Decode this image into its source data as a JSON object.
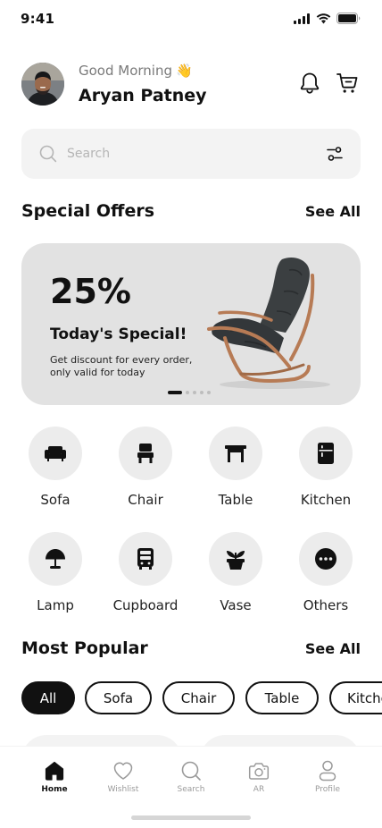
{
  "status_bar": {
    "time": "9:41"
  },
  "header": {
    "greeting": "Good Morning",
    "greeting_emoji": "👋",
    "user_name": "Aryan Patney"
  },
  "search": {
    "placeholder": "Search"
  },
  "special_offers": {
    "title": "Special Offers",
    "see_all": "See All",
    "offer": {
      "percent": "25%",
      "title": "Today's Special!",
      "description": "Get discount for every order, only valid for today"
    },
    "carousel": {
      "count": 5,
      "active_index": 0
    }
  },
  "categories": [
    {
      "label": "Sofa",
      "icon": "sofa-icon"
    },
    {
      "label": "Chair",
      "icon": "chair-icon"
    },
    {
      "label": "Table",
      "icon": "table-icon"
    },
    {
      "label": "Kitchen",
      "icon": "kitchen-icon"
    },
    {
      "label": "Lamp",
      "icon": "lamp-icon"
    },
    {
      "label": "Cupboard",
      "icon": "cupboard-icon"
    },
    {
      "label": "Vase",
      "icon": "vase-icon"
    },
    {
      "label": "Others",
      "icon": "more-icon"
    }
  ],
  "most_popular": {
    "title": "Most Popular",
    "see_all": "See All",
    "filters": [
      "All",
      "Sofa",
      "Chair",
      "Table",
      "Kitchen"
    ],
    "active_filter": "All"
  },
  "bottom_nav": [
    {
      "label": "Home",
      "icon": "home-icon",
      "active": true
    },
    {
      "label": "Wishlist",
      "icon": "heart-icon",
      "active": false
    },
    {
      "label": "Search",
      "icon": "search-icon",
      "active": false
    },
    {
      "label": "AR",
      "icon": "camera-icon",
      "active": false
    },
    {
      "label": "Profile",
      "icon": "profile-icon",
      "active": false
    }
  ],
  "colors": {
    "accent": "#111111",
    "surface": "#f3f3f3",
    "card": "#e2e2e2",
    "chair_wood": "#b77b55",
    "chair_leather": "#3b3f41"
  }
}
